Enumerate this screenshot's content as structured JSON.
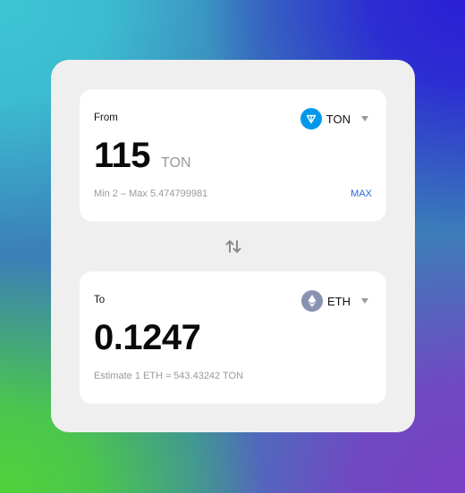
{
  "from": {
    "label": "From",
    "token": "TON",
    "amount": "115",
    "unit": "TON",
    "range": "Min 2 – Max 5.474799981",
    "max_label": "MAX"
  },
  "to": {
    "label": "To",
    "token": "ETH",
    "amount": "0.1247",
    "estimate": "Estimate 1 ETH ≈ 543.43242 TON"
  },
  "icons": {
    "from_token": "ton-logo-icon",
    "to_token": "ethereum-logo-icon",
    "swap": "swap-arrows-icon",
    "dropdown": "chevron-down-icon"
  },
  "colors": {
    "ton": "#0098ea",
    "eth": "#8a92b2",
    "accent": "#2b6ad9"
  }
}
